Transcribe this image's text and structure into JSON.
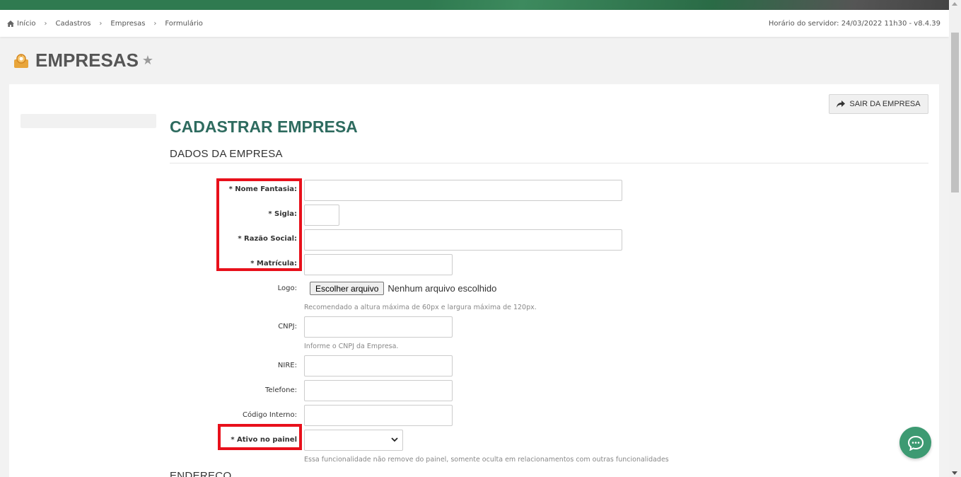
{
  "breadcrumb": {
    "items": [
      "Início",
      "Cadastros",
      "Empresas",
      "Formulário"
    ]
  },
  "server_info": "Horário do servidor: 24/03/2022 11h30 - v8.4.39",
  "page": {
    "title": "EMPRESAS",
    "logo_icon": "company-logo-icon",
    "favorite_icon": "star-icon"
  },
  "actions": {
    "exit_company": "SAIR DA EMPRESA",
    "exit_icon": "share-arrow-icon"
  },
  "form": {
    "title": "CADASTRAR EMPRESA",
    "section_company": "DADOS DA EMPRESA",
    "section_address": "ENDEREÇO",
    "fields": {
      "nome_fantasia": {
        "label": "* Nome Fantasia:",
        "value": ""
      },
      "sigla": {
        "label": "* Sigla:",
        "value": ""
      },
      "razao_social": {
        "label": "* Razão Social:",
        "value": ""
      },
      "matricula": {
        "label": "* Matrícula:",
        "value": ""
      },
      "logo": {
        "label": "Logo:",
        "button": "Escolher arquivo",
        "status": "Nenhum arquivo escolhido",
        "help": "Recomendado a altura máxima de 60px e largura máxima de 120px."
      },
      "cnpj": {
        "label": "CNPJ:",
        "value": "",
        "help": "Informe o CNPJ da Empresa."
      },
      "nire": {
        "label": "NIRE:",
        "value": ""
      },
      "telefone": {
        "label": "Telefone:",
        "value": ""
      },
      "codigo_interno": {
        "label": "Código Interno:",
        "value": ""
      },
      "ativo_painel": {
        "label": "* Ativo no painel",
        "selected": "",
        "help": "Essa funcionalidade não remove do painel, somente oculta em relacionamentos com outras funcionalidades"
      }
    }
  },
  "colors": {
    "title_green": "#2e6b5f",
    "highlight_red": "#e8101b",
    "chat_green": "#3d9a72"
  },
  "chat_icon": "chat-bubble-icon"
}
